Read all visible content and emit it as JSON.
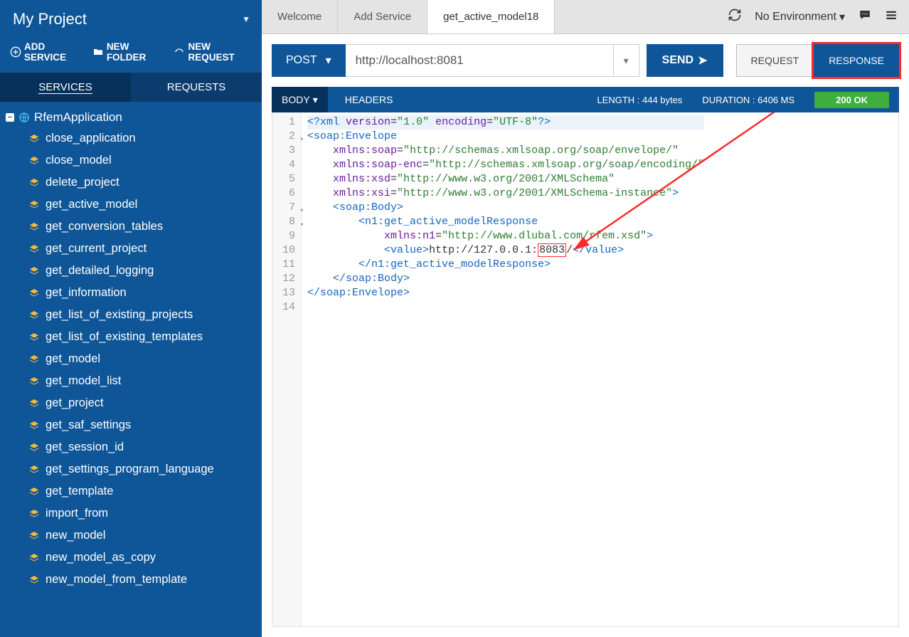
{
  "sidebar": {
    "project_title": "My Project",
    "actions": {
      "add_service": "ADD SERVICE",
      "new_folder": "NEW FOLDER",
      "new_request": "NEW REQUEST"
    },
    "tabs": {
      "services": "SERVICES",
      "requests": "REQUESTS"
    },
    "root_label": "RfemApplication",
    "items": [
      "close_application",
      "close_model",
      "delete_project",
      "get_active_model",
      "get_conversion_tables",
      "get_current_project",
      "get_detailed_logging",
      "get_information",
      "get_list_of_existing_projects",
      "get_list_of_existing_templates",
      "get_model",
      "get_model_list",
      "get_project",
      "get_saf_settings",
      "get_session_id",
      "get_settings_program_language",
      "get_template",
      "import_from",
      "new_model",
      "new_model_as_copy",
      "new_model_from_template"
    ]
  },
  "topbar": {
    "tabs": [
      "Welcome",
      "Add Service",
      "get_active_model18"
    ],
    "active_tab": 2,
    "environment": "No Environment"
  },
  "request": {
    "method": "POST",
    "url": "http://localhost:8081",
    "send": "SEND",
    "request_label": "REQUEST",
    "response_label": "RESPONSE"
  },
  "response_bar": {
    "body_label": "BODY",
    "headers_label": "HEADERS",
    "length": "LENGTH : 444 bytes",
    "duration": "DURATION : 6406 MS",
    "status": "200 OK"
  },
  "code": {
    "value_port": "8083",
    "lines": [
      "<?xml version=\"1.0\" encoding=\"UTF-8\"?>",
      "<soap:Envelope",
      "    xmlns:soap=\"http://schemas.xmlsoap.org/soap/envelope/\"",
      "    xmlns:soap-enc=\"http://schemas.xmlsoap.org/soap/encoding/\"",
      "    xmlns:xsd=\"http://www.w3.org/2001/XMLSchema\"",
      "    xmlns:xsi=\"http://www.w3.org/2001/XMLSchema-instance\">",
      "    <soap:Body>",
      "        <n1:get_active_modelResponse",
      "            xmlns:n1=\"http://www.dlubal.com/rfem.xsd\">",
      "            <value>http://127.0.0.1:8083/</value>",
      "        </n1:get_active_modelResponse>",
      "    </soap:Body>",
      "</soap:Envelope>",
      ""
    ]
  }
}
